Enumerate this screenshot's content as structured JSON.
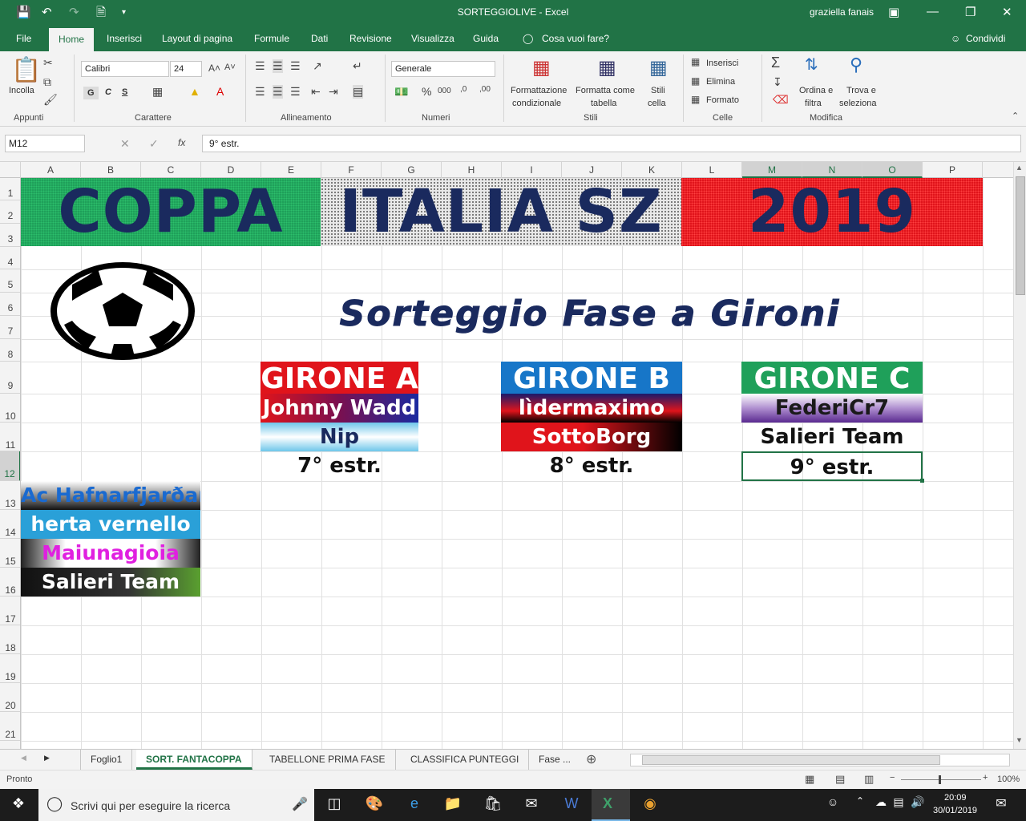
{
  "title": "SORTEGGIOLIVE  -  Excel",
  "user": "graziella fanais",
  "ribbon_tabs": [
    "File",
    "Home",
    "Inserisci",
    "Layout di pagina",
    "Formule",
    "Dati",
    "Revisione",
    "Visualizza",
    "Guida",
    "Cosa vuoi fare?"
  ],
  "share_label": "Condividi",
  "groups": {
    "appunti": "Appunti",
    "carattere": "Carattere",
    "allineamento": "Allineamento",
    "numeri": "Numeri",
    "stili": "Stili",
    "celle": "Celle",
    "modifica": "Modifica"
  },
  "buttons": {
    "incolla": "Incolla",
    "font": "Calibri",
    "size": "24",
    "bold": "G",
    "italic": "C",
    "underline": "S",
    "number_format": "Generale",
    "cond_format_1": "Formattazione",
    "cond_format_2": "condizionale",
    "table_format_1": "Formatta come",
    "table_format_2": "tabella",
    "cell_styles_1": "Stili",
    "cell_styles_2": "cella",
    "insert": "Inserisci",
    "delete": "Elimina",
    "format": "Formato",
    "sort_1": "Ordina e",
    "sort_2": "filtra",
    "find_1": "Trova e",
    "find_2": "seleziona"
  },
  "formula_bar": {
    "cell_ref": "M12",
    "formula": "9° estr.",
    "fx": "fx"
  },
  "columns": [
    "A",
    "B",
    "C",
    "D",
    "E",
    "F",
    "G",
    "H",
    "I",
    "J",
    "K",
    "L",
    "M",
    "N",
    "O",
    "P"
  ],
  "rows": [
    "1",
    "2",
    "3",
    "4",
    "5",
    "6",
    "7",
    "8",
    "9",
    "10",
    "11",
    "12",
    "13",
    "14",
    "15",
    "16",
    "17",
    "18",
    "19",
    "20",
    "21"
  ],
  "sheet": {
    "banner": [
      "COPPA",
      "ITALIA SZ",
      "2019"
    ],
    "subtitle": "Sorteggio Fase a Gironi",
    "groups": [
      {
        "title": "GIRONE A",
        "team1": "Johnny Wadd",
        "team2": "Nip",
        "extra": "7° estr."
      },
      {
        "title": "GIRONE B",
        "team1": "lìdermaximo",
        "team2": "SottoBorg",
        "extra": "8° estr."
      },
      {
        "title": "GIRONE C",
        "team1": "FederiCr7",
        "team2": "Salieri Team",
        "extra": "9° estr."
      }
    ],
    "pool": [
      "Ac Hafnarfjarðar",
      "herta vernello",
      "Maiunagioia",
      "Salieri Team"
    ]
  },
  "sheet_tabs": [
    "Foglio1",
    "SORT. FANTACOPPA",
    "TABELLONE PRIMA FASE",
    "CLASSIFICA PUNTEGGI",
    "Fase ..."
  ],
  "status": {
    "left": "Pronto",
    "zoom": "100%"
  },
  "taskbar": {
    "search": "Scrivi qui per eseguire la ricerca",
    "time": "20:09",
    "date": "30/01/2019"
  },
  "colors": {
    "excel_green": "#217346",
    "banner_text": "#1a2a5e",
    "green": "#1fa05a",
    "red": "#e0141b",
    "blue": "#1776c8"
  }
}
